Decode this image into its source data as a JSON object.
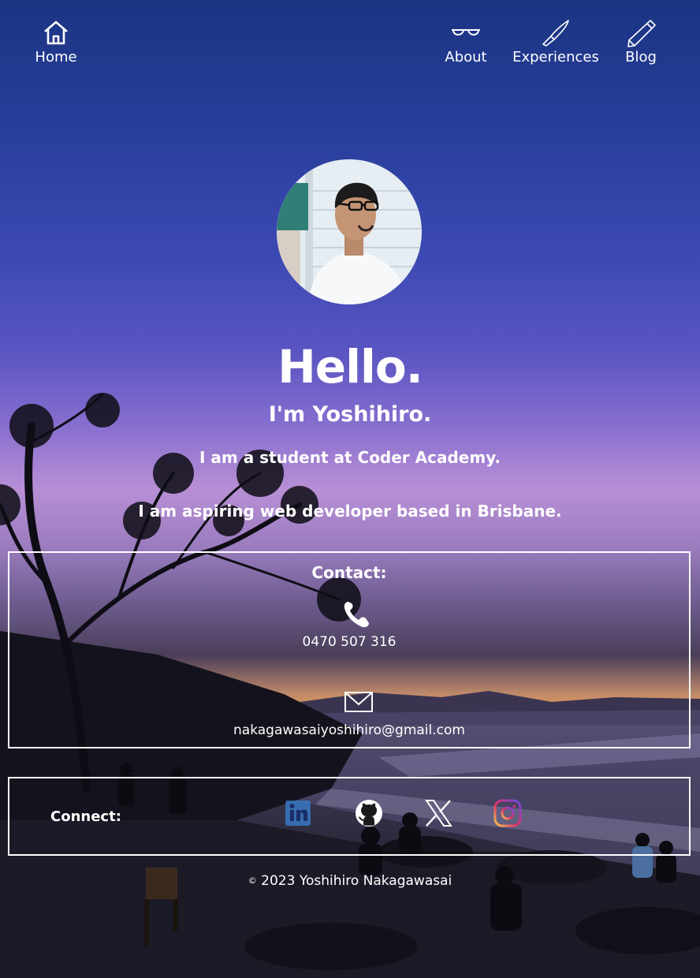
{
  "nav": {
    "home": {
      "label": "Home",
      "icon": "home-icon"
    },
    "about": {
      "label": "About",
      "icon": "glasses-icon"
    },
    "experiences": {
      "label": "Experiences",
      "icon": "knife-icon"
    },
    "blog": {
      "label": "Blog",
      "icon": "pencil-icon"
    }
  },
  "hero": {
    "avatar": "profile-photo",
    "greeting": "Hello.",
    "name": "I'm Yoshihiro.",
    "line1": "I am a student at Coder Academy.",
    "line2": "I am aspiring web developer based in Brisbane."
  },
  "contact": {
    "title": "Contact:",
    "phone_icon": "phone-icon",
    "phone": "0470 507 316",
    "email_icon": "envelope-icon",
    "email": "nakagawasaiyoshihiro@gmail.com"
  },
  "connect": {
    "label": "Connect:",
    "links": [
      {
        "name": "linkedin",
        "icon": "linkedin-icon",
        "color": "#0a66c2"
      },
      {
        "name": "github",
        "icon": "github-icon",
        "color": "#ffffff"
      },
      {
        "name": "x",
        "icon": "x-icon",
        "color": "#ffffff"
      },
      {
        "name": "instagram",
        "icon": "instagram-icon",
        "color": "#e1306c"
      }
    ]
  },
  "footer": {
    "copyright_symbol": "©",
    "text": "2023 Yoshihiro Nakagawasai"
  },
  "colors": {
    "sky_top": "#1b3482",
    "sky_mid": "#8a70cf",
    "sunset": "#e39a58",
    "text": "#ffffff"
  }
}
